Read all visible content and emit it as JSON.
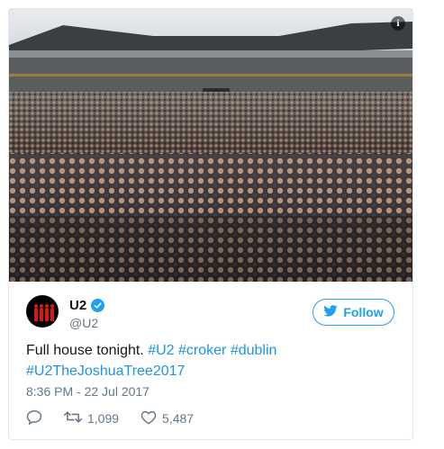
{
  "tweet": {
    "display_name": "U2",
    "handle": "@U2",
    "follow_label": "Follow",
    "text_plain": "Full house tonight.",
    "hashtags": [
      "#U2",
      "#croker",
      "#dublin",
      "#U2TheJoshuaTree2017"
    ],
    "timestamp": "8:36 PM - 22 Jul 2017",
    "retweet_count": "1,099",
    "like_count": "5,487",
    "info_glyph": "i"
  },
  "icons": [
    "info-icon",
    "verified-icon",
    "twitter-bird-icon",
    "reply-icon",
    "retweet-icon",
    "like-icon"
  ],
  "colors": {
    "accent": "#1da1f2",
    "hashtag": "#1b95e0",
    "muted": "#657786",
    "avatar_figures": "#d81818"
  }
}
